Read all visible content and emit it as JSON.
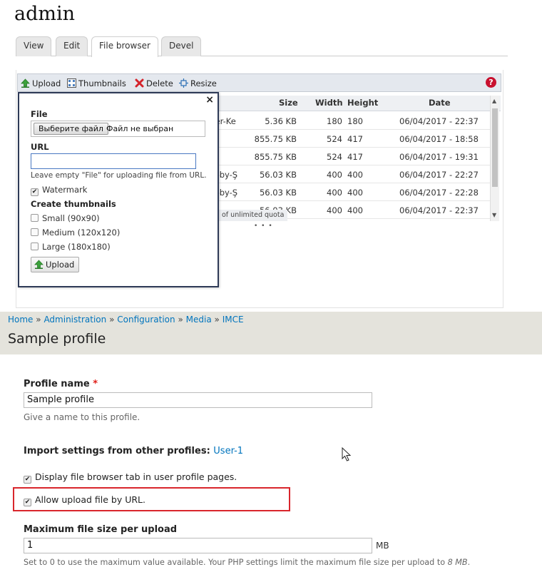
{
  "top": {
    "title": "admin",
    "tabs": [
      {
        "label": "View"
      },
      {
        "label": "Edit"
      },
      {
        "label": "File browser"
      },
      {
        "label": "Devel"
      }
    ],
    "toolbar": {
      "upload": "Upload",
      "thumbnails": "Thumbnails",
      "delete": "Delete",
      "resize": "Resize",
      "help": "?"
    },
    "file_list": {
      "headers": {
        "size": "Size",
        "width": "Width",
        "height": "Height",
        "date": "Date"
      },
      "rows": [
        {
          "name": "ter-Ke",
          "size": "5.36 KB",
          "width": "180",
          "height": "180",
          "date": "06/04/2017 - 22:37"
        },
        {
          "name": "",
          "size": "855.75 KB",
          "width": "524",
          "height": "417",
          "date": "06/04/2017 - 18:58"
        },
        {
          "name": "",
          "size": "855.75 KB",
          "width": "524",
          "height": "417",
          "date": "06/04/2017 - 19:31"
        },
        {
          "name": "y-by-Ş",
          "size": "56.03 KB",
          "width": "400",
          "height": "400",
          "date": "06/04/2017 - 22:27"
        },
        {
          "name": "y-by-Ş",
          "size": "56.03 KB",
          "width": "400",
          "height": "400",
          "date": "06/04/2017 - 22:28"
        },
        {
          "name": "",
          "size": "56.03 KB",
          "width": "400",
          "height": "400",
          "date": "06/04/2017 - 22:37"
        }
      ],
      "quota": "of unlimited quota",
      "resize_handle": "• • •"
    },
    "upload_popup": {
      "close": "×",
      "file_label": "File",
      "file_button": "Выберите файл",
      "file_none": "Файл не выбран",
      "url_label": "URL",
      "url_value": "",
      "url_hint": "Leave empty \"File\" for uploading file from URL.",
      "watermark": "Watermark",
      "thumbnails_label": "Create thumbnails",
      "thumbs": [
        {
          "label": "Small (90x90)"
        },
        {
          "label": "Medium (120x120)"
        },
        {
          "label": "Large (180x180)"
        }
      ],
      "upload_button": "Upload"
    }
  },
  "bottom": {
    "breadcrumb": [
      "Home",
      "Administration",
      "Configuration",
      "Media",
      "IMCE"
    ],
    "breadcrumb_sep": "»",
    "title": "Sample profile",
    "profile_name_label": "Profile name",
    "required_mark": "*",
    "profile_name_value": "Sample profile",
    "profile_name_desc": "Give a name to this profile.",
    "import_label": "Import settings from other profiles",
    "import_link": "User-1",
    "display_tab": "Display file browser tab in user profile pages.",
    "allow_url": "Allow upload file by URL.",
    "max_size_label": "Maximum file size per upload",
    "max_size_value": "1",
    "max_size_unit": "MB",
    "max_size_desc": "Set to 0 to use the maximum value available. Your PHP settings limit the maximum file size per upload to",
    "max_size_limit": "8 MB",
    "max_size_end": "."
  },
  "colors": {
    "link": "#0074bd",
    "highlight": "#d9262c",
    "band": "#e4e3dc"
  }
}
